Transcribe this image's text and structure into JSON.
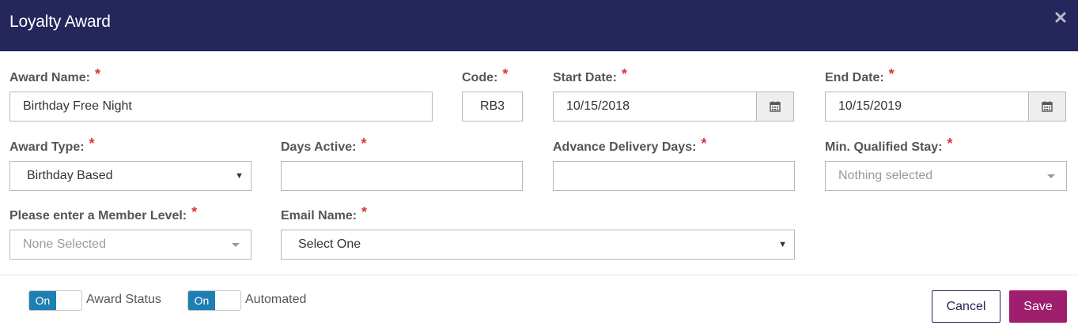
{
  "dialog": {
    "title": "Loyalty Award",
    "close_icon": "close-icon"
  },
  "required_mark": "*",
  "fields": {
    "award_name": {
      "label": "Award Name:",
      "value": "Birthday Free Night"
    },
    "code": {
      "label": "Code:",
      "value": "RB3"
    },
    "start_date": {
      "label": "Start Date:",
      "value": "10/15/2018"
    },
    "end_date": {
      "label": "End Date:",
      "value": "10/15/2019"
    },
    "award_type": {
      "label": "Award Type:",
      "value": "Birthday Based"
    },
    "days_active": {
      "label": "Days Active:",
      "value": ""
    },
    "advance_delivery_days": {
      "label": "Advance Delivery Days:",
      "value": ""
    },
    "min_qualified_stay": {
      "label": "Min. Qualified Stay:",
      "placeholder": "Nothing selected"
    },
    "member_level": {
      "label": "Please enter a Member Level:",
      "placeholder": "None Selected"
    },
    "email_name": {
      "label": "Email Name:",
      "value": "Select One"
    }
  },
  "toggles": {
    "award_status": {
      "state": "On",
      "label": "Award Status"
    },
    "automated": {
      "state": "On",
      "label": "Automated"
    }
  },
  "buttons": {
    "cancel": "Cancel",
    "save": "Save"
  },
  "colors": {
    "header": "#25265c",
    "required": "#d9363e",
    "toggle_on": "#1e7fb5",
    "save": "#a01e6e"
  }
}
